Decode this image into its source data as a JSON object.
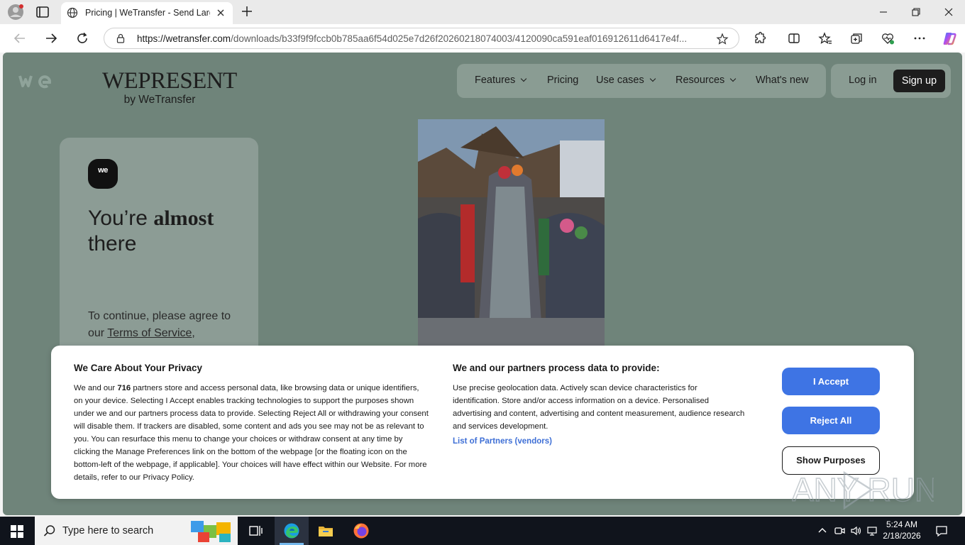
{
  "browser": {
    "tab_title": "Pricing | WeTransfer - Send Large Files & Share Photos",
    "url_host": "https://wetransfer.com",
    "url_path": "/downloads/b33f9f9fccb0b785aa6f54d025e7d26f20260218074003/4120090ca591eaf016912611d6417e4f..."
  },
  "site": {
    "logo_text": "we",
    "brand_main": "WEPRESENT",
    "brand_sub": "by WeTransfer",
    "nav": {
      "features": "Features",
      "pricing": "Pricing",
      "use_cases": "Use cases",
      "resources": "Resources",
      "whats_new": "What's new",
      "login": "Log in",
      "signup": "Sign up"
    }
  },
  "card": {
    "logo_text": "we",
    "heading_pre": "You’re ",
    "heading_bold": "almost",
    "heading_post": "there",
    "body_pre": "To continue, please agree to our ",
    "body_link": "Terms of Service",
    "body_post": ","
  },
  "cookie": {
    "left_title": "We Care About Your Privacy",
    "left_text_pre": "We and our ",
    "partners_count": "716",
    "left_text_post": " partners store and access personal data, like browsing data or unique identifiers, on your device. Selecting I Accept enables tracking technologies to support the purposes shown under we and our partners process data to provide. Selecting Reject All or withdrawing your consent will disable them. If trackers are disabled, some content and ads you see may not be as relevant to you. You can resurface this menu to change your choices or withdraw consent at any time by clicking the Manage Preferences link on the bottom of the webpage [or the floating icon on the bottom-left of the webpage, if applicable]. Your choices will have effect within our Website. For more details, refer to our Privacy Policy.",
    "right_title": "We and our partners process data to provide:",
    "right_text": "Use precise geolocation data. Actively scan device characteristics for identification. Store and/or access information on a device. Personalised advertising and content, advertising and content measurement, audience research and services development.",
    "vendors_link": "List of Partners (vendors)",
    "accept": "I Accept",
    "reject": "Reject All",
    "purposes": "Show Purposes"
  },
  "watermark": "ANY RUN",
  "taskbar": {
    "search_placeholder": "Type here to search",
    "time": "5:24 AM",
    "date": "2/18/2026"
  },
  "colors": {
    "page_bg": "#6f847a",
    "accent_blue": "#3e74e4",
    "link_blue": "#3e6fd6"
  }
}
